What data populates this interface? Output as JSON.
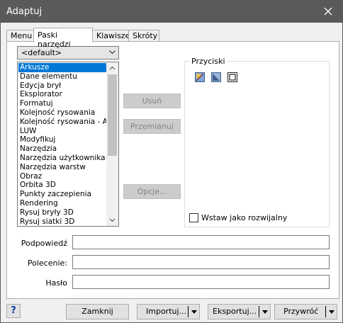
{
  "window": {
    "title": "Adaptuj"
  },
  "tabs": [
    {
      "label": "Menu"
    },
    {
      "label": "Paski narzędzi"
    },
    {
      "label": "Klawisze"
    },
    {
      "label": "Skróty"
    }
  ],
  "toolbar_select": {
    "value": "<default>"
  },
  "toolbar_list": {
    "items": [
      "Arkusze",
      "Dane elementu",
      "Edycja brył",
      "Eksplorator",
      "Formatuj",
      "Kolejność rysowania",
      "Kolejność rysowania - Adr",
      "LUW",
      "Modyfikuj",
      "Narzędzia",
      "Narzędzia użytkownika",
      "Narzędzia warstw",
      "Obraz",
      "Orbita 3D",
      "Punkty zaczepienia",
      "Rendering",
      "Rysuj bryły 3D",
      "Rysuj siatki 3D"
    ],
    "selected_index": 0
  },
  "actions": {
    "delete_label": "Usuń",
    "rename_label": "Przemianuj",
    "options_label": "Opcje..."
  },
  "buttons_group": {
    "label": "Przyciski",
    "icons": [
      "sheet-tool-icon",
      "triangle-tool-icon",
      "frame-tool-icon"
    ],
    "insert_dropdown_label": "Wstaw jako rozwijalny",
    "insert_dropdown_checked": false
  },
  "fields": {
    "tooltip_label": "Podpowiedź",
    "tooltip_value": "",
    "command_label": "Polecenie:",
    "command_value": "",
    "password_label": "Hasło",
    "password_value": ""
  },
  "footer": {
    "help_label": "?",
    "close_label": "Zamknij",
    "import_label": "Importuj...",
    "export_label": "Eksportuj...",
    "restore_label": "Przywróć"
  }
}
